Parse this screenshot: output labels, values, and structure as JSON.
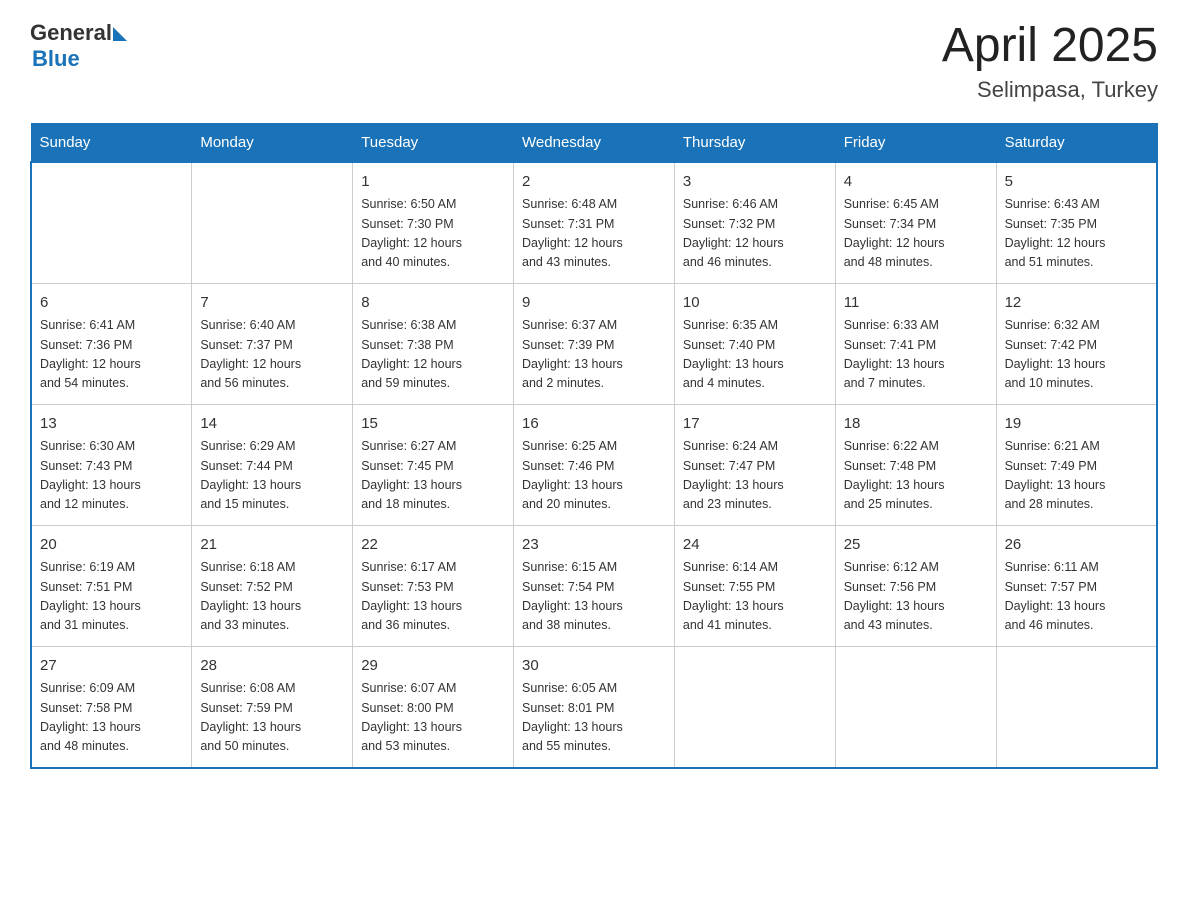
{
  "header": {
    "logo_general": "General",
    "logo_blue": "Blue",
    "title": "April 2025",
    "subtitle": "Selimpasa, Turkey"
  },
  "days_of_week": [
    "Sunday",
    "Monday",
    "Tuesday",
    "Wednesday",
    "Thursday",
    "Friday",
    "Saturday"
  ],
  "weeks": [
    [
      {
        "day": "",
        "info": ""
      },
      {
        "day": "",
        "info": ""
      },
      {
        "day": "1",
        "info": "Sunrise: 6:50 AM\nSunset: 7:30 PM\nDaylight: 12 hours\nand 40 minutes."
      },
      {
        "day": "2",
        "info": "Sunrise: 6:48 AM\nSunset: 7:31 PM\nDaylight: 12 hours\nand 43 minutes."
      },
      {
        "day": "3",
        "info": "Sunrise: 6:46 AM\nSunset: 7:32 PM\nDaylight: 12 hours\nand 46 minutes."
      },
      {
        "day": "4",
        "info": "Sunrise: 6:45 AM\nSunset: 7:34 PM\nDaylight: 12 hours\nand 48 minutes."
      },
      {
        "day": "5",
        "info": "Sunrise: 6:43 AM\nSunset: 7:35 PM\nDaylight: 12 hours\nand 51 minutes."
      }
    ],
    [
      {
        "day": "6",
        "info": "Sunrise: 6:41 AM\nSunset: 7:36 PM\nDaylight: 12 hours\nand 54 minutes."
      },
      {
        "day": "7",
        "info": "Sunrise: 6:40 AM\nSunset: 7:37 PM\nDaylight: 12 hours\nand 56 minutes."
      },
      {
        "day": "8",
        "info": "Sunrise: 6:38 AM\nSunset: 7:38 PM\nDaylight: 12 hours\nand 59 minutes."
      },
      {
        "day": "9",
        "info": "Sunrise: 6:37 AM\nSunset: 7:39 PM\nDaylight: 13 hours\nand 2 minutes."
      },
      {
        "day": "10",
        "info": "Sunrise: 6:35 AM\nSunset: 7:40 PM\nDaylight: 13 hours\nand 4 minutes."
      },
      {
        "day": "11",
        "info": "Sunrise: 6:33 AM\nSunset: 7:41 PM\nDaylight: 13 hours\nand 7 minutes."
      },
      {
        "day": "12",
        "info": "Sunrise: 6:32 AM\nSunset: 7:42 PM\nDaylight: 13 hours\nand 10 minutes."
      }
    ],
    [
      {
        "day": "13",
        "info": "Sunrise: 6:30 AM\nSunset: 7:43 PM\nDaylight: 13 hours\nand 12 minutes."
      },
      {
        "day": "14",
        "info": "Sunrise: 6:29 AM\nSunset: 7:44 PM\nDaylight: 13 hours\nand 15 minutes."
      },
      {
        "day": "15",
        "info": "Sunrise: 6:27 AM\nSunset: 7:45 PM\nDaylight: 13 hours\nand 18 minutes."
      },
      {
        "day": "16",
        "info": "Sunrise: 6:25 AM\nSunset: 7:46 PM\nDaylight: 13 hours\nand 20 minutes."
      },
      {
        "day": "17",
        "info": "Sunrise: 6:24 AM\nSunset: 7:47 PM\nDaylight: 13 hours\nand 23 minutes."
      },
      {
        "day": "18",
        "info": "Sunrise: 6:22 AM\nSunset: 7:48 PM\nDaylight: 13 hours\nand 25 minutes."
      },
      {
        "day": "19",
        "info": "Sunrise: 6:21 AM\nSunset: 7:49 PM\nDaylight: 13 hours\nand 28 minutes."
      }
    ],
    [
      {
        "day": "20",
        "info": "Sunrise: 6:19 AM\nSunset: 7:51 PM\nDaylight: 13 hours\nand 31 minutes."
      },
      {
        "day": "21",
        "info": "Sunrise: 6:18 AM\nSunset: 7:52 PM\nDaylight: 13 hours\nand 33 minutes."
      },
      {
        "day": "22",
        "info": "Sunrise: 6:17 AM\nSunset: 7:53 PM\nDaylight: 13 hours\nand 36 minutes."
      },
      {
        "day": "23",
        "info": "Sunrise: 6:15 AM\nSunset: 7:54 PM\nDaylight: 13 hours\nand 38 minutes."
      },
      {
        "day": "24",
        "info": "Sunrise: 6:14 AM\nSunset: 7:55 PM\nDaylight: 13 hours\nand 41 minutes."
      },
      {
        "day": "25",
        "info": "Sunrise: 6:12 AM\nSunset: 7:56 PM\nDaylight: 13 hours\nand 43 minutes."
      },
      {
        "day": "26",
        "info": "Sunrise: 6:11 AM\nSunset: 7:57 PM\nDaylight: 13 hours\nand 46 minutes."
      }
    ],
    [
      {
        "day": "27",
        "info": "Sunrise: 6:09 AM\nSunset: 7:58 PM\nDaylight: 13 hours\nand 48 minutes."
      },
      {
        "day": "28",
        "info": "Sunrise: 6:08 AM\nSunset: 7:59 PM\nDaylight: 13 hours\nand 50 minutes."
      },
      {
        "day": "29",
        "info": "Sunrise: 6:07 AM\nSunset: 8:00 PM\nDaylight: 13 hours\nand 53 minutes."
      },
      {
        "day": "30",
        "info": "Sunrise: 6:05 AM\nSunset: 8:01 PM\nDaylight: 13 hours\nand 55 minutes."
      },
      {
        "day": "",
        "info": ""
      },
      {
        "day": "",
        "info": ""
      },
      {
        "day": "",
        "info": ""
      }
    ]
  ]
}
